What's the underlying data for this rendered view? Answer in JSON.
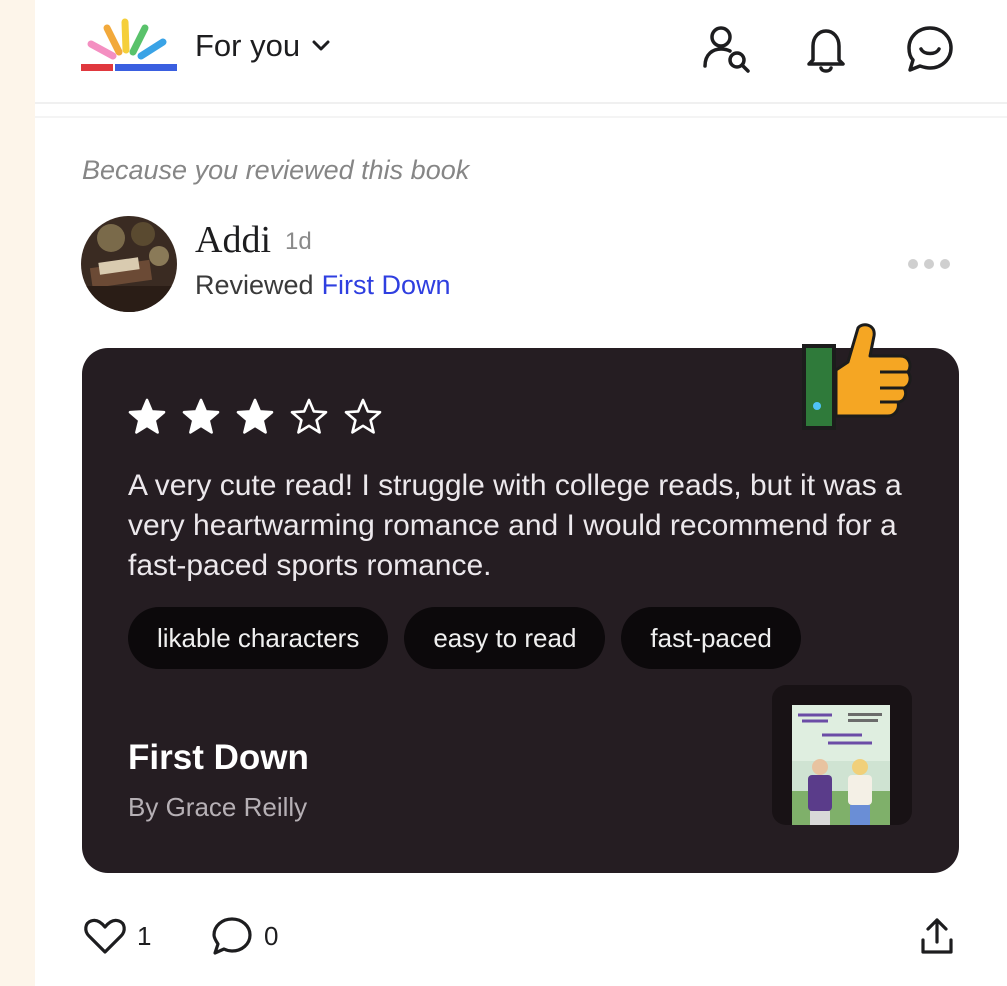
{
  "header": {
    "feed_title": "For you",
    "icons": [
      "logo-icon",
      "chevron-down-icon",
      "find-people-icon",
      "bell-icon",
      "chat-icon"
    ]
  },
  "post": {
    "reason": "Because you reviewed this book",
    "user": {
      "name": "Addi",
      "time": "1d"
    },
    "action_label": "Reviewed",
    "book_link": "First Down",
    "rating": {
      "value": 3,
      "max": 5
    },
    "review_text": "A very cute read! I struggle with college reads, but it was a very heartwarming romance and I would recommend for a fast-paced sports romance.",
    "tags": [
      "likable characters",
      "easy to read",
      "fast-paced"
    ],
    "book": {
      "title": "First Down",
      "author": "By Grace Reilly"
    },
    "likes": "1",
    "comments": "0"
  },
  "colors": {
    "card_bg": "#251d22",
    "link": "#2f3fe0",
    "tag_bg": "#0c090b"
  }
}
